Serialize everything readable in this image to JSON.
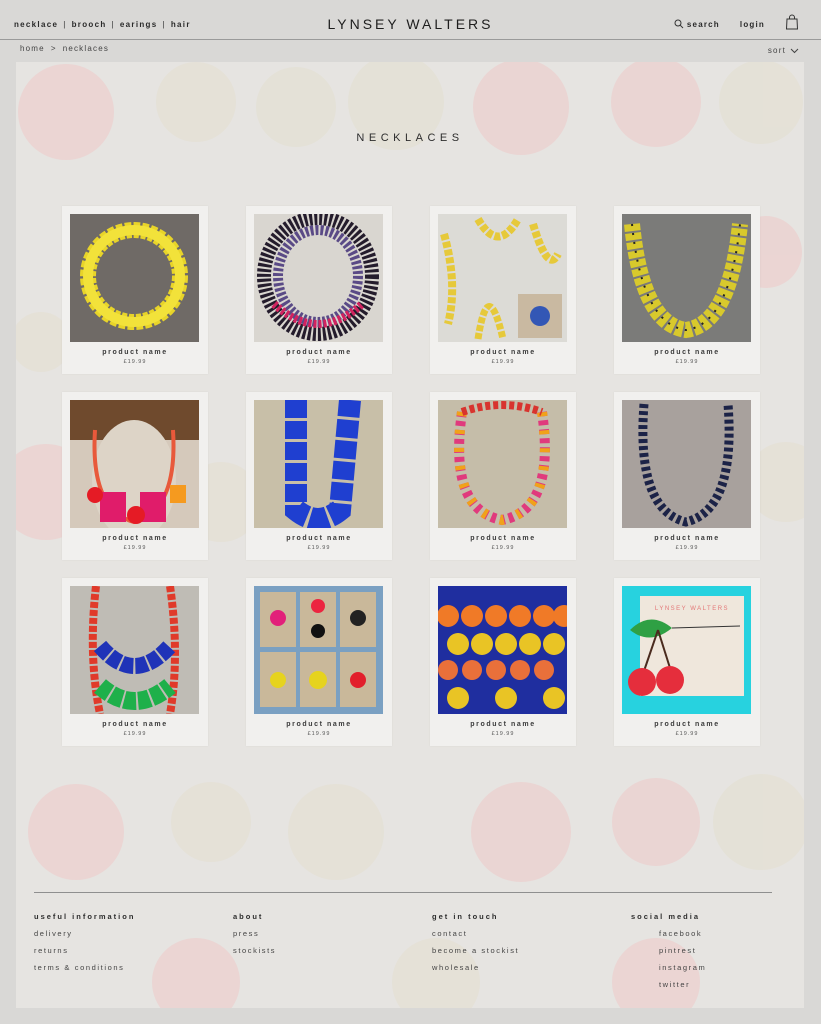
{
  "header": {
    "nav": [
      "necklace",
      "brooch",
      "earings",
      "hair"
    ],
    "brand": "LYNSEY WALTERS",
    "search_label": "search",
    "login_label": "login"
  },
  "breadcrumb": {
    "home": "home",
    "separator": ">",
    "current": "necklaces"
  },
  "sort_label": "sort",
  "page_title": "NECKLACES",
  "products": [
    {
      "name": "product name",
      "price": "£19.99"
    },
    {
      "name": "product name",
      "price": "£19.99"
    },
    {
      "name": "product name",
      "price": "£19.99"
    },
    {
      "name": "product name",
      "price": "£19.99"
    },
    {
      "name": "product name",
      "price": "£19.99"
    },
    {
      "name": "product name",
      "price": "£19.99"
    },
    {
      "name": "product name",
      "price": "£19.99"
    },
    {
      "name": "product name",
      "price": "£19.99"
    },
    {
      "name": "product name",
      "price": "£19.99"
    },
    {
      "name": "product name",
      "price": "£19.99"
    },
    {
      "name": "product name",
      "price": "£19.99"
    },
    {
      "name": "product name",
      "price": "£19.99"
    }
  ],
  "footer": {
    "useful_information": {
      "heading": "useful information",
      "links": [
        "delivery",
        "returns",
        "terms & conditions"
      ]
    },
    "about": {
      "heading": "about",
      "links": [
        "press",
        "stockists"
      ]
    },
    "get_in_touch": {
      "heading": "get in touch",
      "links": [
        "contact",
        "become a stockist",
        "wholesale"
      ]
    },
    "social_media": {
      "heading": "social media",
      "links": [
        "facebook",
        "pintrest",
        "instagram",
        "twitter"
      ]
    }
  },
  "product_tile_text": "LYNSEY WALTERS",
  "colors": {
    "page_bg": "#d9d8d6",
    "panel_bg": "#e6e4e1",
    "card_bg": "#f1f0ee",
    "pattern_pink": "#eec9c9",
    "pattern_cream": "#e3dfcf"
  }
}
